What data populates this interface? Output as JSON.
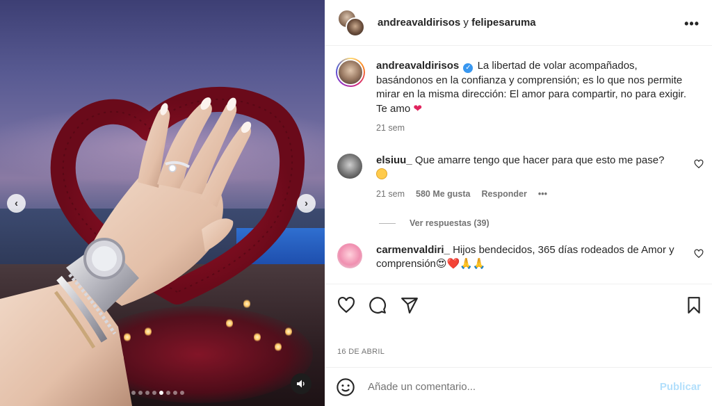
{
  "header": {
    "user_primary": "andreavaldirisos",
    "joiner": "y",
    "user_secondary": "felipesaruma",
    "more_icon": "more-horizontal-icon"
  },
  "caption": {
    "username": "andreavaldirisos",
    "verified": true,
    "text": "La libertad de volar acompañados, basándonos en la confianza y comprensión; es lo que nos permite mirar en la misma dirección: El amor para compartir, no para exigir.",
    "text_line2": "Te amo",
    "emoji": "❤",
    "time": "21 sem"
  },
  "comments": [
    {
      "username": "elsiuu_",
      "text": "Que amarre tengo que hacer para que esto me pase?",
      "time": "21 sem",
      "likes": "580 Me gusta",
      "reply_label": "Responder",
      "more": "•••",
      "view_replies": "Ver respuestas (39)"
    },
    {
      "username": "carmenvaldiri_",
      "text": "Hijos bendecidos, 365 días rodeados de Amor y comprensión",
      "emojis": "😍❤️🙏🙏"
    }
  ],
  "media": {
    "carousel_dots": 8,
    "active_dot": 4,
    "prev_icon": "chevron-left-icon",
    "next_icon": "chevron-right-icon",
    "audio_icon": "speaker-icon"
  },
  "actions": {
    "like_icon": "heart-outline-icon",
    "comment_icon": "comment-bubble-icon",
    "share_icon": "paper-plane-icon",
    "save_icon": "bookmark-icon"
  },
  "date": "16 DE ABRIL",
  "add_comment": {
    "placeholder": "Añade un comentario...",
    "publish_label": "Publicar",
    "emoji_icon": "smiley-icon"
  },
  "colors": {
    "text": "#262626",
    "secondary": "#737373",
    "publish_disabled": "#b2dffc",
    "verified": "#3897f0",
    "heart": "#e0245e"
  }
}
